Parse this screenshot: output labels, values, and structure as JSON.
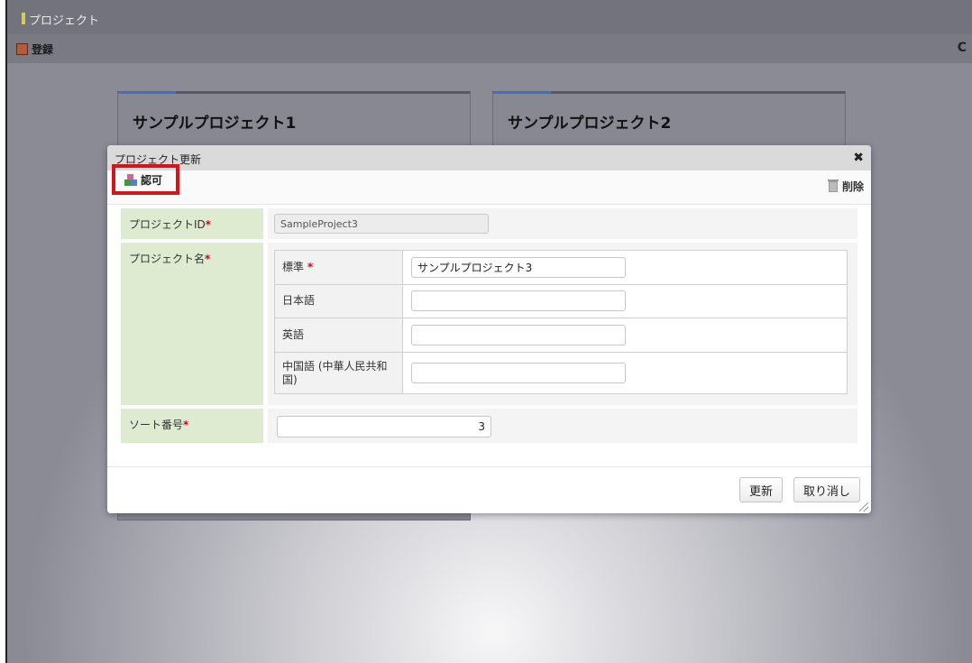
{
  "app": {
    "title": "プロジェクト"
  },
  "toolbar": {
    "register_label": "登録",
    "refresh_icon": "refresh-icon"
  },
  "cards": [
    {
      "title": "サンプルプロジェクト1"
    },
    {
      "title": "サンプルプロジェクト2"
    }
  ],
  "dialog": {
    "title": "プロジェクト更新",
    "approve_label": "認可",
    "delete_label": "削除",
    "fields": {
      "project_id": {
        "label": "プロジェクトID",
        "required": "*",
        "value": "SampleProject3"
      },
      "project_name": {
        "label": "プロジェクト名",
        "required": "*",
        "languages": [
          {
            "label": "標準",
            "required": "*",
            "value": "サンプルプロジェクト3"
          },
          {
            "label": "日本語",
            "value": ""
          },
          {
            "label": "英語",
            "value": ""
          },
          {
            "label": "中国語 (中華人民共和国)",
            "value": ""
          }
        ]
      },
      "sort_no": {
        "label": "ソート番号",
        "required": "*",
        "value": "3"
      }
    },
    "buttons": {
      "update": "更新",
      "cancel": "取り消し"
    }
  },
  "colors": {
    "accent": "#3c6fcf",
    "label_bg": "#deebd1",
    "required": "#e0001a",
    "highlight": "#d6141b"
  }
}
